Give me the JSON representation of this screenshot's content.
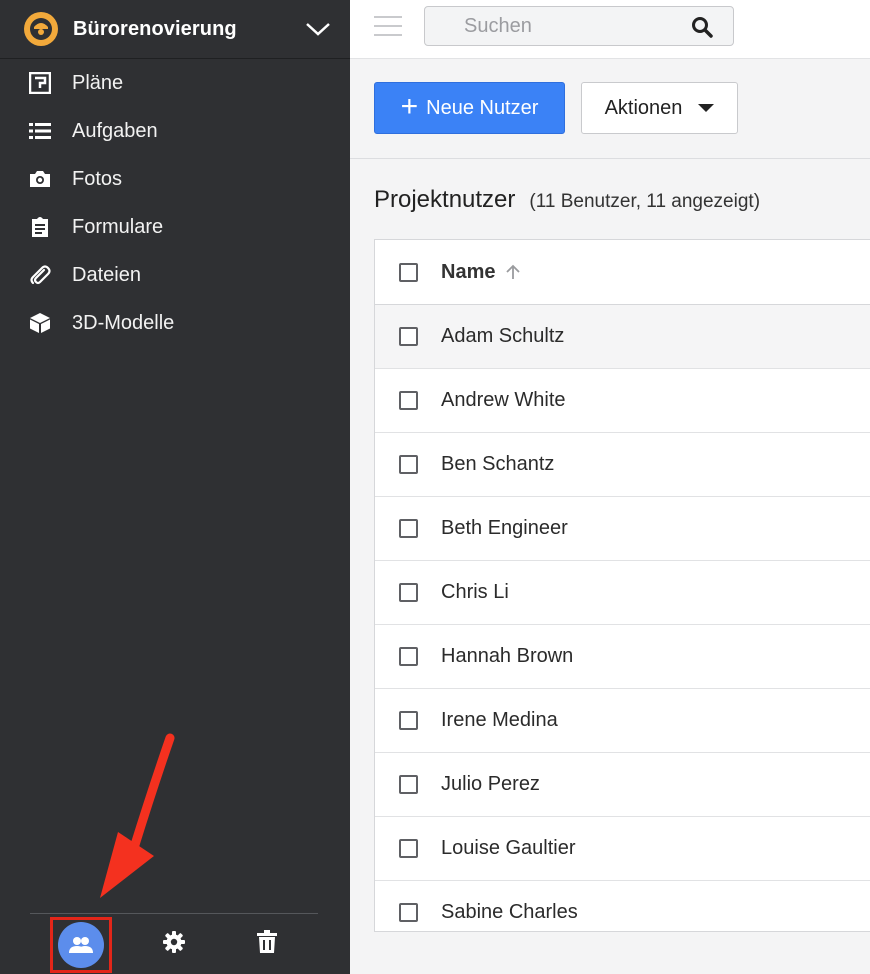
{
  "project": {
    "name": "Bürorenovierung"
  },
  "nav": {
    "items": [
      {
        "label": "Pläne",
        "icon": "plans-icon"
      },
      {
        "label": "Aufgaben",
        "icon": "list-icon"
      },
      {
        "label": "Fotos",
        "icon": "camera-icon"
      },
      {
        "label": "Formulare",
        "icon": "clipboard-icon"
      },
      {
        "label": "Dateien",
        "icon": "paperclip-icon"
      },
      {
        "label": "3D-Modelle",
        "icon": "cube-icon"
      }
    ]
  },
  "search": {
    "placeholder": "Suchen"
  },
  "toolbar": {
    "new_user_label": "Neue Nutzer",
    "actions_label": "Aktionen"
  },
  "section": {
    "title": "Projektnutzer",
    "count": "(11 Benutzer, 11 angezeigt)"
  },
  "table": {
    "column_name": "Name",
    "rows": [
      "Adam Schultz",
      "Andrew White",
      "Ben Schantz",
      "Beth Engineer",
      "Chris Li",
      "Hannah Brown",
      "Irene Medina",
      "Julio Perez",
      "Louise Gaultier",
      "Sabine Charles"
    ]
  },
  "colors": {
    "sidebar_bg": "#2f3033",
    "primary": "#3b82f6",
    "highlight": "#e32619",
    "users_button": "#5c8dec"
  }
}
